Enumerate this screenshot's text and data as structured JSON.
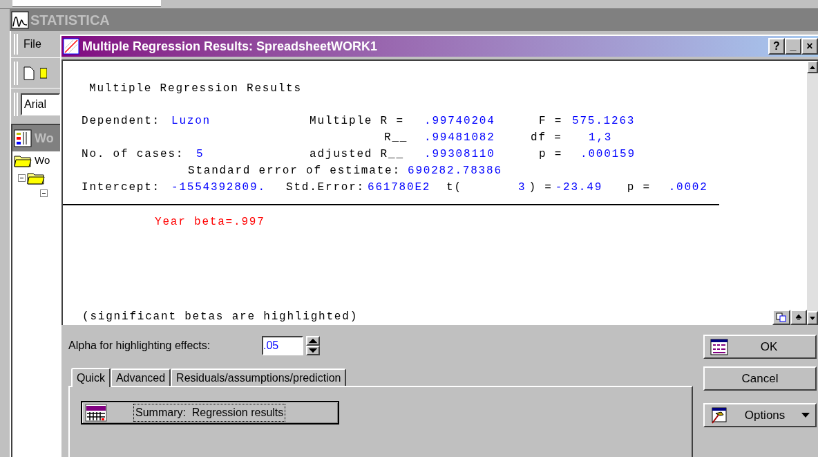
{
  "app": {
    "title": "STATISTICA",
    "menu": [
      "File"
    ],
    "font_field": "Arial",
    "workbook": {
      "title": "Wo",
      "tree": [
        {
          "label": "Wo"
        }
      ]
    }
  },
  "dialog": {
    "title": "Multiple Regression Results: SpreadsheetWORK1",
    "title_buttons": [
      "?",
      "_",
      "×"
    ],
    "heading": "Multiple Regression Results",
    "lines": [
      [
        {
          "text": "Dependent:",
          "kind": "label"
        },
        {
          "text": "Luzon",
          "kind": "value"
        },
        {
          "text": "Multiple R =",
          "kind": "label"
        },
        {
          "text": ".99740204",
          "kind": "value"
        },
        {
          "text": "F =",
          "kind": "label"
        },
        {
          "text": "575.1263",
          "kind": "value"
        }
      ],
      [
        {
          "text": "R__",
          "kind": "label"
        },
        {
          "text": ".99481082",
          "kind": "value"
        },
        {
          "text": "df =",
          "kind": "label"
        },
        {
          "text": "1,3",
          "kind": "value"
        }
      ],
      [
        {
          "text": "No. of cases:",
          "kind": "label"
        },
        {
          "text": "5",
          "kind": "value"
        },
        {
          "text": "adjusted R__",
          "kind": "label"
        },
        {
          "text": ".99308110",
          "kind": "value"
        },
        {
          "text": "p =",
          "kind": "label"
        },
        {
          "text": ".000159",
          "kind": "value"
        }
      ],
      [
        {
          "text": "Standard error of estimate:",
          "kind": "label"
        },
        {
          "text": "690282.78386",
          "kind": "value"
        }
      ],
      [
        {
          "text": "Intercept:",
          "kind": "label"
        },
        {
          "text": "-1554392809.",
          "kind": "value"
        },
        {
          "text": "Std.Error:",
          "kind": "label"
        },
        {
          "text": "661780E2",
          "kind": "value"
        },
        {
          "text": "t(",
          "kind": "label"
        },
        {
          "text": "3",
          "kind": "value"
        },
        {
          "text": ") =",
          "kind": "label"
        },
        {
          "text": "-23.49",
          "kind": "value"
        },
        {
          "text": "p =",
          "kind": "label"
        },
        {
          "text": ".0002",
          "kind": "value"
        }
      ]
    ],
    "note": "Year beta=.997",
    "footer": "(significant betas are highlighted)",
    "alpha": {
      "label": "Alpha for highlighting effects:",
      "value": ".05"
    },
    "tabs": [
      {
        "label": "Quick",
        "selected": true
      },
      {
        "label": "Advanced",
        "selected": false
      },
      {
        "label": "Residuals/assumptions/prediction",
        "selected": false
      }
    ],
    "summary_button": "Summary:  Regression results",
    "buttons": [
      {
        "label": "OK",
        "kind": "ok"
      },
      {
        "label": "Cancel",
        "kind": "plain"
      },
      {
        "label": "Options",
        "kind": "menu"
      }
    ]
  }
}
